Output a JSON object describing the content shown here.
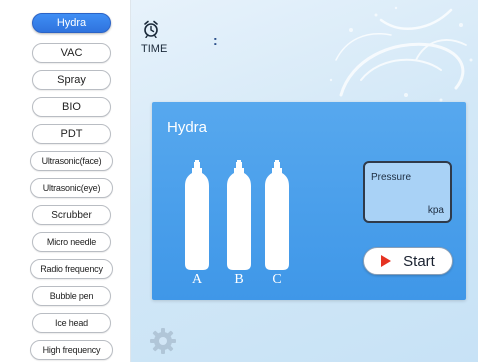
{
  "sidebar": {
    "items": [
      {
        "label": "Hydra",
        "active": true
      },
      {
        "label": "VAC",
        "active": false
      },
      {
        "label": "Spray",
        "active": false
      },
      {
        "label": "BIO",
        "active": false
      },
      {
        "label": "PDT",
        "active": false
      },
      {
        "label": "Ultrasonic(face)",
        "active": false
      },
      {
        "label": "Ultrasonic(eye)",
        "active": false
      },
      {
        "label": "Scrubber",
        "active": false
      },
      {
        "label": "Micro needle",
        "active": false
      },
      {
        "label": "Radio frequency",
        "active": false
      },
      {
        "label": "Bubble pen",
        "active": false
      },
      {
        "label": "Ice head",
        "active": false
      },
      {
        "label": "High frequency",
        "active": false
      }
    ]
  },
  "header": {
    "time_label": "TIME",
    "time_value": ":",
    "clock_icon": "alarm-clock-icon"
  },
  "panel": {
    "title": "Hydra",
    "bottles": [
      {
        "label": "A"
      },
      {
        "label": "B"
      },
      {
        "label": "C"
      }
    ],
    "pressure": {
      "label": "Pressure",
      "unit": "kpa"
    },
    "start_label": "Start"
  },
  "colors": {
    "accent": "#3f8ef4",
    "panel": "#4a9fec",
    "play": "#e53322"
  },
  "settings_icon": "gear-icon"
}
